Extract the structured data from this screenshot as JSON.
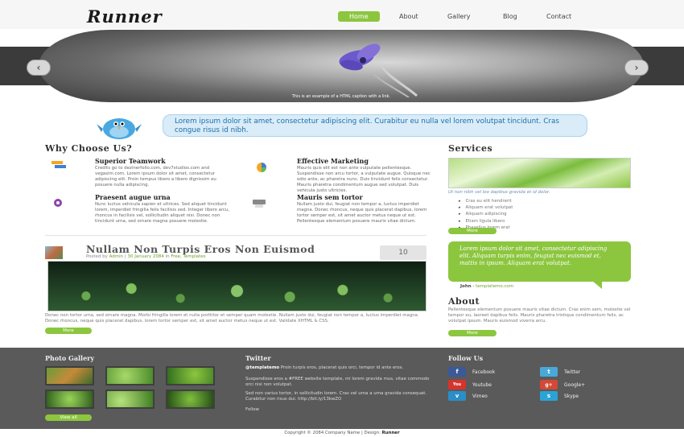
{
  "header": {
    "logo": "Runner",
    "nav": [
      {
        "label": "Home",
        "active": true
      },
      {
        "label": "About"
      },
      {
        "label": "Gallery"
      },
      {
        "label": "Blog"
      },
      {
        "label": "Contact"
      }
    ]
  },
  "slider": {
    "caption": "This is an example of a HTML caption with a link."
  },
  "intro": {
    "text": "Lorem ipsum dolor sit amet, consectetur adipiscing elit. Curabitur eu nulla vel lorem volutpat tincidunt. Cras congue risus id nibh."
  },
  "why": {
    "title": "Why Choose Us?",
    "features": [
      {
        "title": "Superior Teamwork",
        "body": "Credits go to dezinerfolio.com, dev7studios.com and vegasim.com. Lorem ipsum dolor sit amet, consectetur adipiscing elit. Proin tempus libero a libero dignissim eu posuere nulla adipiscing."
      },
      {
        "title": "Effective Marketing",
        "body": "Mauris quis elit est non ante vulputate pellentesque. Suspendisse non arcu tortor, a vulputate augue. Quisque nec odio ante, ac pharetra nunc. Duis tincidunt felis consectetur. Mauris pharetra condimentum augue sed volutpat. Duis vehicula justo ultricies."
      },
      {
        "title": "Praesent augue urna",
        "body": "Nunc luctus vehicula sapien et ultrices. Sed aliquet tincidunt lorem, imperdiet fringilla felis facilisis sed. Integer libero arcu, rhoncus in facilisis vel, sollicitudin aliquet nisi. Donec non tincidunt urna, sed ornare magna posuere molestie."
      },
      {
        "title": "Mauris sem tortor",
        "body": "Nullam justo dui, feugiat non tempor a, luctus imperdiet magna. Donec rhoncus, neque quis placerat dapibus, lorem tortor semper est, sit amet auctor metus neque ut est. Pellentesque elementum posuere mauris vitae dictum."
      }
    ]
  },
  "post": {
    "title": "Nullam Non Turpis Eros Non Euismod",
    "meta_prefix": "Posted by",
    "author": "Admin",
    "date": "30 January 2084",
    "meta_in": "in",
    "categories": "Free, Templates",
    "comments": "10",
    "body": "Donec non tortor urna, sed ornare magna. Morbi fringilla lorem et nulla porttitor et semper quam molestie. Nullam justo dui, feugiat non tempor a, luctus imperdiet magna. Donec rhoncus, neque quis placerat dapibus, lorem tortor semper est, sit amet auctor metus neque ut est. Validate XHTML & CSS.",
    "more": "More"
  },
  "services": {
    "title": "Services",
    "caption": "Ut non nibh vel leo dapibus gravida et id dolor.",
    "items": [
      "Cras eu elit hendrerit",
      "Aliquam erat volutpat",
      "Aliquam adipiscing",
      "Etiam ligula libero",
      "Phasellus lorem erat"
    ],
    "more": "More"
  },
  "testimonial": {
    "quote": "Lorem ipsum dolor sit amet, consectetur adipiscing elit. Aliquam turpis enim, feugiat nec euismod et, mattis in ipsum. Aliquam erat volutpat.",
    "author": "John",
    "site": "templatemo.com"
  },
  "about": {
    "title": "About",
    "body": "Pellentesque elementum posuere mauris vitae dictum. Cras enim sem, molestie vel tempor eu, laoreet dapibus felis. Mauris pharetra tristique condimentum felis, ac volutpat ipsum. Mauris euismod viverra arcu.",
    "more": "More"
  },
  "footer": {
    "gallery_title": "Photo Gallery",
    "gallery_button": "View all",
    "twitter_title": "Twitter",
    "tweets": [
      {
        "user": "@templatemo",
        "text": "Proin turpis eros, placerat quis orci, tempor id ante eros."
      },
      {
        "user": "",
        "text": "Suspendisse eros a #FREE website template, mi lorem gravida mus, vitae commodo orci nisi non volutpat."
      },
      {
        "user": "",
        "text": "Sed non varius tortor, in sollicitudin lorem. Cras vel urna a urna gravida consequat. Curabitur non risus dui. http://bit.ly/13kwZO"
      }
    ],
    "twitter_follow": "Follow",
    "follow_title": "Follow Us",
    "social": [
      {
        "label": "Facebook",
        "icon": "f",
        "color": "#3b5998"
      },
      {
        "label": "Twitter",
        "icon": "t",
        "color": "#4aa8d8"
      },
      {
        "label": "Youtube",
        "icon": "You",
        "color": "#d6332c"
      },
      {
        "label": "Google+",
        "icon": "g+",
        "color": "#d34836"
      },
      {
        "label": "Vimeo",
        "icon": "v",
        "color": "#2a8ec8"
      },
      {
        "label": "Skype",
        "icon": "s",
        "color": "#2aa4d8"
      }
    ],
    "copyright_prefix": "Copyright © 2084 Company Name | Design:",
    "copyright_brand": "Runner"
  }
}
